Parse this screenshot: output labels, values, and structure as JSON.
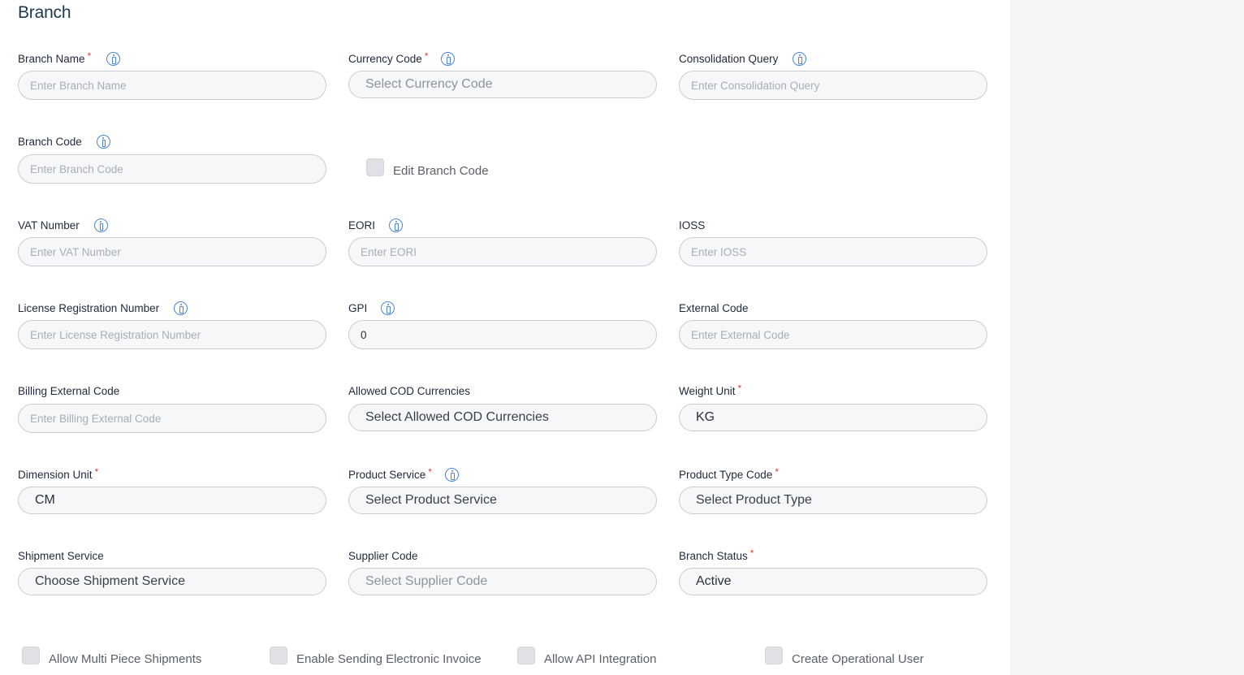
{
  "page": {
    "title": "Branch"
  },
  "fields": {
    "branch_name": {
      "label": "Branch Name",
      "placeholder": "Enter Branch Name"
    },
    "currency_code": {
      "label": "Currency Code",
      "placeholder": "Select Currency Code"
    },
    "consolidation_query": {
      "label": "Consolidation Query",
      "placeholder": "Enter Consolidation Query"
    },
    "branch_code": {
      "label": "Branch Code",
      "placeholder": "Enter Branch Code"
    },
    "edit_branch_code": {
      "label": "Edit Branch Code"
    },
    "vat_number": {
      "label": "VAT Number",
      "placeholder": "Enter VAT Number"
    },
    "eori": {
      "label": "EORI",
      "placeholder": "Enter EORI"
    },
    "ioss": {
      "label": "IOSS",
      "placeholder": "Enter IOSS"
    },
    "license_registration_number": {
      "label": "License Registration Number",
      "placeholder": "Enter License Registration Number"
    },
    "gpi": {
      "label": "GPI",
      "value": "0"
    },
    "external_code": {
      "label": "External Code",
      "placeholder": "Enter External Code"
    },
    "billing_external_code": {
      "label": "Billing External Code",
      "placeholder": "Enter Billing External Code"
    },
    "allowed_cod_currencies": {
      "label": "Allowed COD Currencies",
      "placeholder": "Select Allowed COD Currencies"
    },
    "weight_unit": {
      "label": "Weight Unit",
      "value": "KG"
    },
    "dimension_unit": {
      "label": "Dimension Unit",
      "value": "CM"
    },
    "product_service": {
      "label": "Product Service",
      "placeholder": "Select Product Service"
    },
    "product_type_code": {
      "label": "Product Type Code",
      "placeholder": "Select Product Type"
    },
    "shipment_service": {
      "label": "Shipment Service",
      "placeholder": "Choose Shipment Service"
    },
    "supplier_code": {
      "label": "Supplier Code",
      "placeholder": "Select Supplier Code"
    },
    "branch_status": {
      "label": "Branch Status",
      "value": "Active"
    }
  },
  "checkboxes": {
    "allow_multi_piece": "Allow Multi Piece Shipments",
    "enable_electronic_invoice": "Enable Sending Electronic Invoice",
    "allow_api_integration": "Allow API Integration",
    "create_operational_user": "Create Operational User"
  },
  "required_marker": "*",
  "colors": {
    "info_icon": "#4a84d8",
    "required": "#e53935",
    "input_border": "#c8ccd2",
    "input_bg": "#f6f7f9",
    "side_panel": "#f5f6f8"
  },
  "icons": {
    "info": "info-icon",
    "checkbox": "checkbox-icon"
  }
}
